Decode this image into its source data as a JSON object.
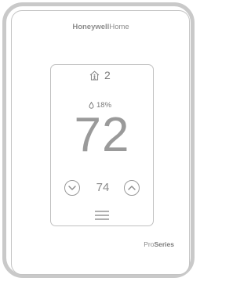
{
  "device": {
    "brand_bold": "Honeywell",
    "brand_regular": "Home",
    "series_regular": "Pro",
    "series_bold": "Series"
  },
  "display": {
    "occupancy_icon": "home-person-icon",
    "occupancy_count": "2",
    "humidity_icon": "droplet-icon",
    "humidity": "18%",
    "current_temp": "72",
    "setpoint": "74",
    "down_icon": "chevron-down-icon",
    "up_icon": "chevron-up-icon",
    "menu_icon": "menu-icon"
  },
  "colors": {
    "frame": "#c9c9c9",
    "text": "#8c8c8c"
  }
}
